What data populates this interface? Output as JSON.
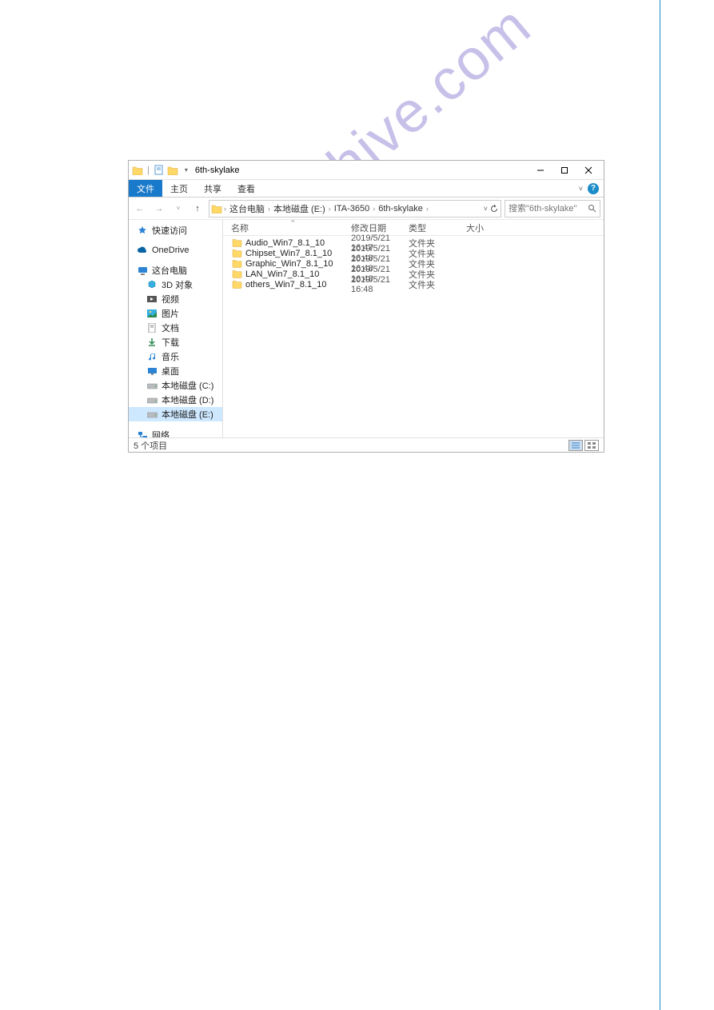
{
  "watermark": "manualshive.com",
  "titlebar": {
    "title": "6th-skylake"
  },
  "ribbon": {
    "tabs": [
      "文件",
      "主页",
      "共享",
      "查看"
    ]
  },
  "breadcrumb": [
    "这台电脑",
    "本地磁盘 (E:)",
    "ITA-3650",
    "6th-skylake"
  ],
  "search": {
    "placeholder": "搜索\"6th-skylake\""
  },
  "columns": {
    "name": "名称",
    "date": "修改日期",
    "type": "类型",
    "size": "大小"
  },
  "sidebar": {
    "quick": "快速访问",
    "onedrive": "OneDrive",
    "thispc": "这台电脑",
    "pc_children": [
      {
        "label": "3D 对象",
        "icon": "3d"
      },
      {
        "label": "视频",
        "icon": "video"
      },
      {
        "label": "图片",
        "icon": "pictures"
      },
      {
        "label": "文档",
        "icon": "documents"
      },
      {
        "label": "下载",
        "icon": "downloads"
      },
      {
        "label": "音乐",
        "icon": "music"
      },
      {
        "label": "桌面",
        "icon": "desktop"
      },
      {
        "label": "本地磁盘 (C:)",
        "icon": "drive"
      },
      {
        "label": "本地磁盘 (D:)",
        "icon": "drive"
      },
      {
        "label": "本地磁盘 (E:)",
        "icon": "drive",
        "selected": true
      }
    ],
    "network": "网络"
  },
  "files": [
    {
      "name": "Audio_Win7_8.1_10",
      "date": "2019/5/21 16:47",
      "type": "文件夹"
    },
    {
      "name": "Chipset_Win7_8.1_10",
      "date": "2019/5/21 16:48",
      "type": "文件夹"
    },
    {
      "name": "Graphic_Win7_8.1_10",
      "date": "2019/5/21 16:48",
      "type": "文件夹"
    },
    {
      "name": "LAN_Win7_8.1_10",
      "date": "2019/5/21 16:48",
      "type": "文件夹"
    },
    {
      "name": "others_Win7_8.1_10",
      "date": "2019/5/21 16:48",
      "type": "文件夹"
    }
  ],
  "statusbar": {
    "text": "5 个项目"
  }
}
